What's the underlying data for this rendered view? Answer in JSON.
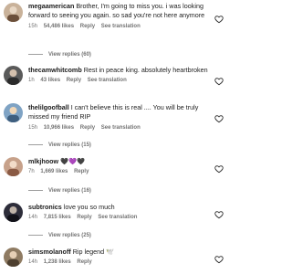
{
  "comments": [
    {
      "username": "megaamerican",
      "text": "Brother, I'm going to miss you. i was looking forward to seeing you again. so sad you're not here anymore",
      "time": "15h",
      "likes": "54,486 likes",
      "reply": "Reply",
      "translation": "See translation",
      "view_replies": "View replies (60)",
      "avatar_color": "#c9b29a"
    },
    {
      "username": "thecamwhitcomb",
      "text": "Rest in peace king. absolutely heartbroken",
      "time": "1h",
      "likes": "43 likes",
      "reply": "Reply",
      "translation": "See translation",
      "avatar_color": "#5a5a5a"
    },
    {
      "username": "thelilgoofball",
      "text": "I can't believe this is real .... You will be truly missed my friend RIP",
      "time": "15h",
      "likes": "10,966 likes",
      "reply": "Reply",
      "translation": "See translation",
      "view_replies": "View replies (15)",
      "avatar_color": "#7fa3c4"
    },
    {
      "username": "mlkjhoow",
      "text": "🖤💜🖤",
      "time": "7h",
      "likes": "1,669 likes",
      "reply": "Reply",
      "view_replies": "View replies (16)",
      "avatar_color": "#c7a18a"
    },
    {
      "username": "subtronics",
      "text": "love you so much",
      "time": "14h",
      "likes": "7,815 likes",
      "reply": "Reply",
      "translation": "See translation",
      "view_replies": "View replies (25)",
      "avatar_color": "#2d2d3a"
    },
    {
      "username": "simsmolanoff",
      "text": "Rip legend 🕊️",
      "time": "14h",
      "likes": "1,238 likes",
      "reply": "Reply",
      "avatar_color": "#8f7b62"
    }
  ],
  "colors": {
    "meta": "#737373",
    "heart_outline": "#262626",
    "divider": "#9e9e9e"
  },
  "icons": [
    "heart-outline-icon",
    "avatar"
  ]
}
